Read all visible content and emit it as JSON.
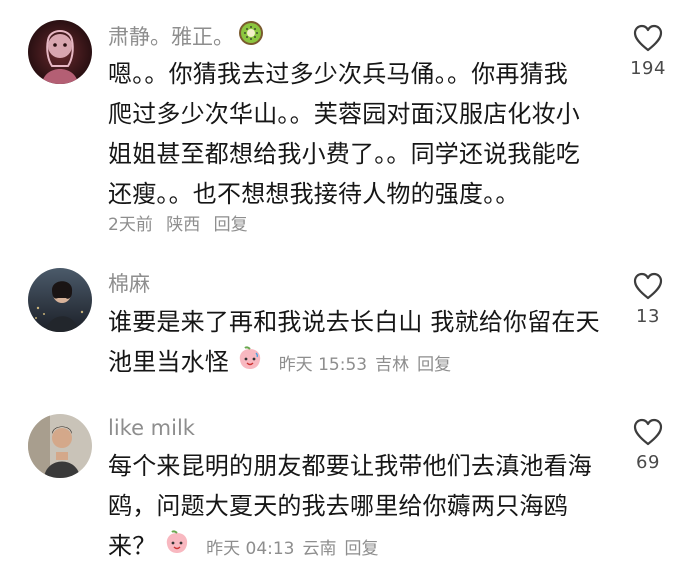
{
  "comments": [
    {
      "username": "肃静。雅正。",
      "text": "嗯。。你猜我去过多少次兵马俑。。你再猜我爬过多少次华山。。芙蓉园对面汉服店化妆小姐姐甚至都想给我小费了。。同学还说我能吃还瘦。。也不想想我接待人物的强度。。",
      "lines": [
        "嗯。。你猜我去过多少次兵马俑。。你再猜我",
        "爬过多少次华山。。芙蓉园对面汉服店化妆小",
        "姐姐甚至都想给我小费了。。同学还说我能吃",
        "还瘦。。也不想想我接待人物的强度。。"
      ],
      "time": "2天前",
      "location": "陕西",
      "reply_label": "回复",
      "likes": "194",
      "avatar_color": "#2b0f12"
    },
    {
      "username": "棉麻",
      "lines": [
        "谁要是来了再和我说去长白山 我就给你留在天",
        "池里当水怪"
      ],
      "time": "昨天 15:53",
      "location": "吉林",
      "reply_label": "回复",
      "likes": "13"
    },
    {
      "username": "like milk",
      "lines": [
        "每个来昆明的朋友都要让我带他们去滇池看海",
        "鸥，问题大夏天的我去哪里给你薅两只海鸥",
        "来？"
      ],
      "time": "昨天 04:13",
      "location": "云南",
      "reply_label": "回复",
      "likes": "69"
    }
  ],
  "icons": {
    "like": "heart-outline-icon",
    "kiwi": "kiwi-emoji-icon",
    "peach": "peach-face-emoji-icon"
  }
}
